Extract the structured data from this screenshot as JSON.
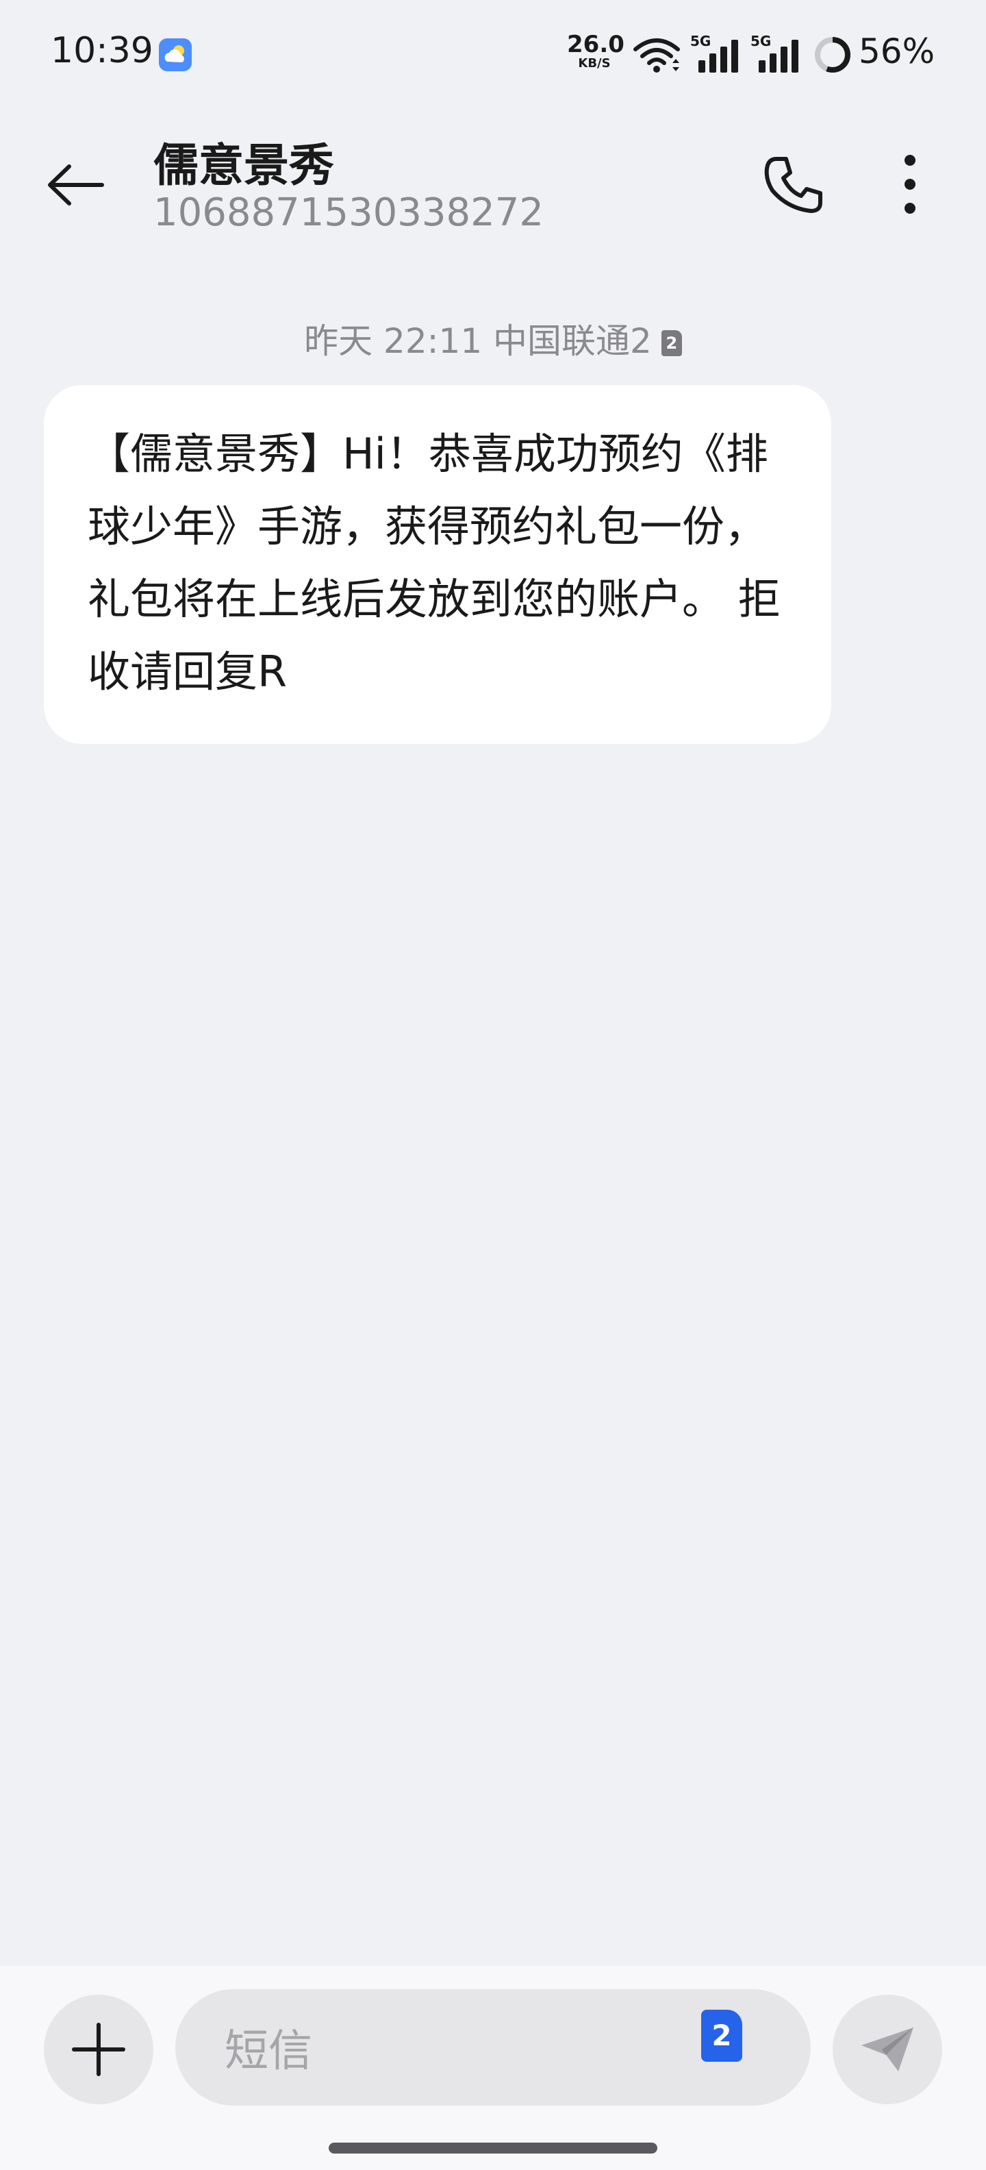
{
  "status_bar": {
    "time": "10:39",
    "net_speed_value": "26.0",
    "net_speed_unit": "KB/S",
    "signal_1_label": "5G",
    "signal_2_label": "5G",
    "battery_percent": "56%",
    "battery_level": 0.56,
    "icons": {
      "weather": "weather-partly-cloudy-icon",
      "wifi": "wifi-icon",
      "signal": "cellular-signal-icon",
      "battery": "battery-ring-icon"
    }
  },
  "header": {
    "contact_name": "儒意景秀",
    "contact_number": "1068871530338272",
    "icons": {
      "back": "arrow-left-icon",
      "call": "phone-icon",
      "more": "more-vertical-icon"
    }
  },
  "conversation": {
    "timestamp": "昨天 22:11 中国联通2",
    "sim_badge": "2",
    "messages": [
      {
        "direction": "incoming",
        "text": "【儒意景秀】Hi！恭喜成功预约《排球少年》手游，获得预约礼包一份，礼包将在上线后发放到您的账户。 拒收请回复R"
      }
    ]
  },
  "input_bar": {
    "placeholder": "短信",
    "sim_selected": "2",
    "icons": {
      "add": "plus-icon",
      "sim": "sim-card-icon",
      "send": "send-icon"
    }
  },
  "colors": {
    "background": "#f0f1f4",
    "bubble": "#ffffff",
    "accent_sim": "#2563eb",
    "secondary_text": "#8a8a8e"
  }
}
